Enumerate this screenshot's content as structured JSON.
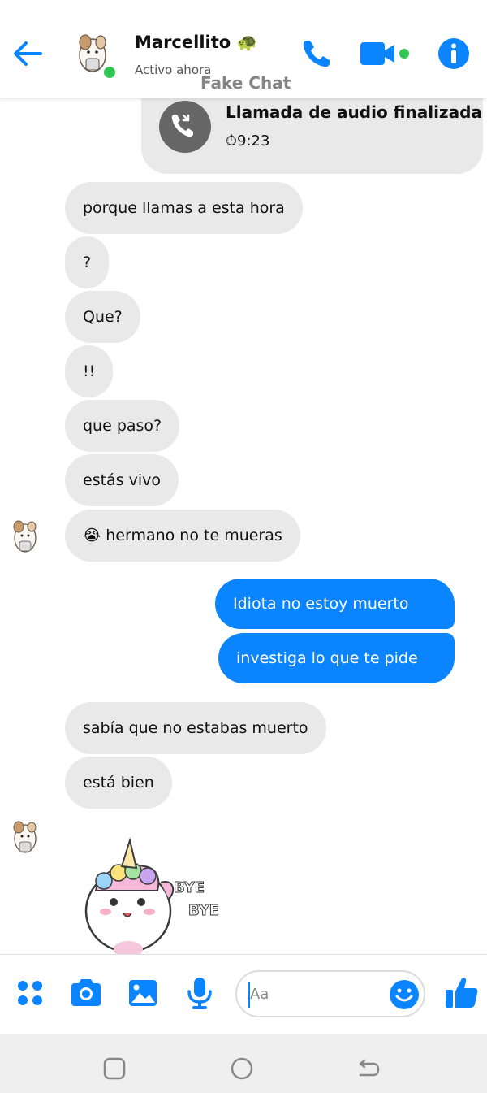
{
  "header": {
    "contact_name": "Marcellito 🐢",
    "status": "Activo ahora",
    "watermark": "Fake Chat"
  },
  "call": {
    "title": "Llamada de audio finalizada",
    "time": "⏱9:23"
  },
  "messages": {
    "m1": "porque llamas a esta hora",
    "m2": "?",
    "m3": "Que?",
    "m4": "!!",
    "m5": "que paso?",
    "m6": "estás vivo",
    "m7": "😭 hermano no te mueras",
    "m8": "Idiota no estoy muerto",
    "m9": "investiga lo que te pide",
    "m10": "sabía que no estabas muerto",
    "m11": "está bien"
  },
  "sticker": {
    "text_line1": "BYE",
    "text_line2": "BYE"
  },
  "composer": {
    "placeholder": "Aa"
  },
  "colors": {
    "accent": "#0a84ff",
    "incoming": "#e9e9e9",
    "online": "#31c553"
  },
  "icons": [
    "back-arrow-icon",
    "phone-icon",
    "video-icon",
    "info-icon",
    "missed-call-icon",
    "apps-icon",
    "camera-icon",
    "gallery-icon",
    "microphone-icon",
    "emoji-icon",
    "thumbs-up-icon",
    "recent-apps-icon",
    "home-icon",
    "back-icon"
  ]
}
